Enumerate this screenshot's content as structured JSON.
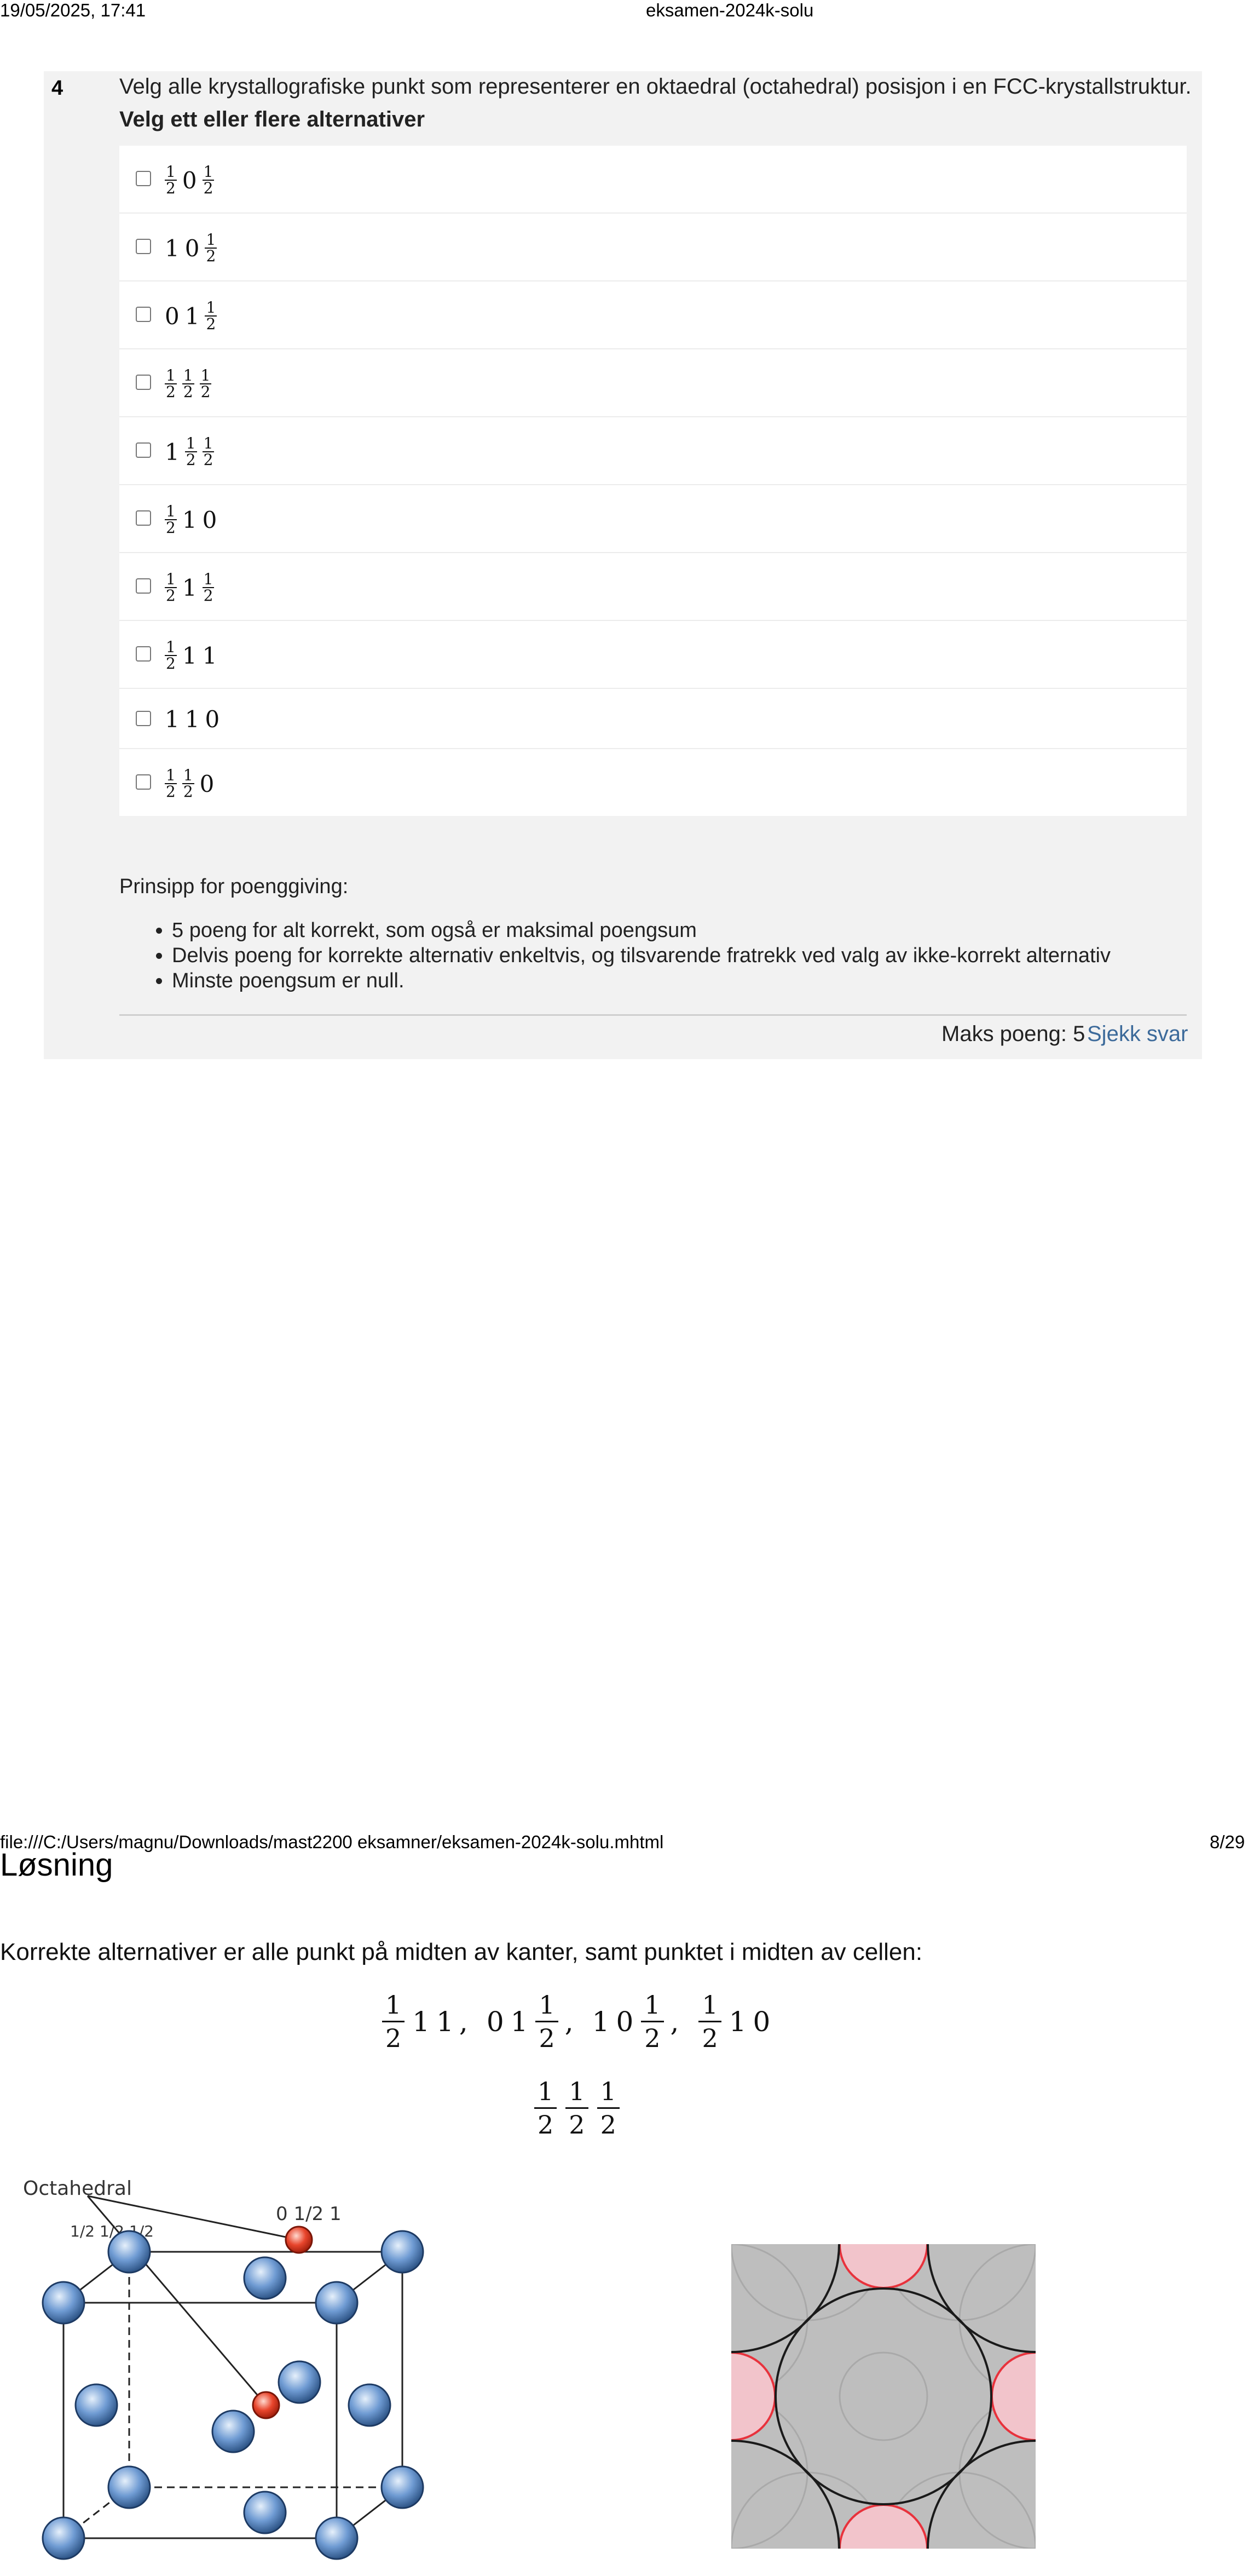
{
  "header": {
    "datetime": "19/05/2025, 17:41",
    "doc_title": "eksamen-2024k-solu"
  },
  "question": {
    "number": "4",
    "text": "Velg alle krystallografiske punkt som representerer en oktaedral (octahedral) posisjon i en FCC-krystallstruktur.",
    "instruction": "Velg ett eller flere alternativer",
    "options": [
      {
        "label": "1/2 0 1/2",
        "parts": [
          "1/2",
          "0",
          "1/2"
        ]
      },
      {
        "label": "1 0 1/2",
        "parts": [
          "1",
          "0",
          "1/2"
        ]
      },
      {
        "label": "0 1 1/2",
        "parts": [
          "0",
          "1",
          "1/2"
        ]
      },
      {
        "label": "1/2 1/2 1/2",
        "parts": [
          "1/2",
          "1/2",
          "1/2"
        ]
      },
      {
        "label": "1 1/2 1/2",
        "parts": [
          "1",
          "1/2",
          "1/2"
        ]
      },
      {
        "label": "1/2 1 0",
        "parts": [
          "1/2",
          "1",
          "0"
        ]
      },
      {
        "label": "1/2 1 1/2",
        "parts": [
          "1/2",
          "1",
          "1/2"
        ]
      },
      {
        "label": "1/2 1 1",
        "parts": [
          "1/2",
          "1",
          "1"
        ]
      },
      {
        "label": "1 1 0",
        "parts": [
          "1",
          "1",
          "0"
        ]
      },
      {
        "label": "1/2 1/2 0",
        "parts": [
          "1/2",
          "1/2",
          "0"
        ]
      }
    ],
    "scoring_title": "Prinsipp for poenggiving:",
    "scoring_rules": [
      "5 poeng for alt korrekt, som også er maksimal poengsum",
      "Delvis poeng for korrekte alternativ enkeltvis, og tilsvarende fratrekk ved valg av ikke-korrekt alternativ",
      "Minste poengsum er null."
    ],
    "max_points_label": "Maks poeng: 5",
    "check_answer_label": "Sjekk svar"
  },
  "footer": {
    "path": "file:///C:/Users/magnu/Downloads/mast2200 eksamner/eksamen-2024k-solu.mhtml",
    "page": "8/29"
  },
  "solution": {
    "title": "Løsning",
    "text": "Korrekte alternativer er alle punkt på midten av kanter, samt punktet i midten av cellen:",
    "equation_line1": [
      [
        "1/2",
        "1",
        "1"
      ],
      [
        "0",
        "1",
        "1/2"
      ],
      [
        "1",
        "0",
        "1/2"
      ],
      [
        "1/2",
        "1",
        "0"
      ]
    ],
    "equation_line2": [
      "1/2",
      "1/2",
      "1/2"
    ]
  },
  "figure": {
    "label_octahedral": "Octahedral",
    "label_center": "1/2 1/2 1/2",
    "label_edge": "0 1/2 1",
    "colors": {
      "atom": "#6f9bd3",
      "octahedral_site": "#e8452c",
      "overlay_gray": "#bebebe",
      "overlay_red": "#f2c4cb"
    }
  }
}
